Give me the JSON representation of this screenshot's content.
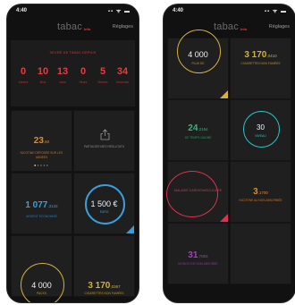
{
  "status": {
    "time": "4:40",
    "icons": "▪▪ ᯤ ▬"
  },
  "app": {
    "logo": "tabac",
    "logo_tag": "Info",
    "settings": "Réglages"
  },
  "left": {
    "quit": {
      "title": "SEVRÉ DE TABAC DEPUIS",
      "counters": [
        {
          "value": "0",
          "unit": "Années"
        },
        {
          "value": "10",
          "unit": "Mois"
        },
        {
          "value": "13",
          "unit": "Jours"
        },
        {
          "value": "0",
          "unit": "Heure"
        },
        {
          "value": "5",
          "unit": "Minutes"
        },
        {
          "value": "34",
          "unit": "Secondes"
        }
      ]
    },
    "tiles": {
      "nicotine": {
        "value": "23",
        "decimal": ",60",
        "label": "NICOTINE DÉPOSÉE SUR LES ANNÉES"
      },
      "share": {
        "label": "PARTAGER MES RÉSULTATS"
      },
      "savings": {
        "value": "1 077",
        "decimal": ",3132",
        "label": "ARGENT ÉCONOMISÉ"
      },
      "goal": {
        "value": "1 500 €",
        "label": "EURO"
      },
      "packs": {
        "value": "4 000",
        "label": "PACKS"
      },
      "cigs": {
        "value": "3 170",
        "decimal": ",0367",
        "label": "CIGARETTES NON FUMÉES"
      }
    },
    "colors": {
      "orange": "#e58a2a",
      "blue": "#3c9ed8",
      "yellow": "#d5b03a"
    }
  },
  "right": {
    "tiles": {
      "packs": {
        "value": "4 000",
        "label": "PLUS DE"
      },
      "cigs": {
        "value": "3 170",
        "decimal": ",0410",
        "label": "CIGARETTES NON FUMÉES"
      },
      "time": {
        "value": "24",
        "decimal": ",2154",
        "label": "DE TEMPS GAGNÉ"
      },
      "level": {
        "value": "30",
        "label": "NIVEAU"
      },
      "disease": {
        "label": "MALADIE CARDIOVASCULAIRE"
      },
      "cigs2": {
        "value": "3",
        "decimal": ",1700",
        "label": "NICOTINE AU NON ABSORBÉE"
      },
      "misc": {
        "value": "31",
        "decimal": ",7004",
        "label": "MONOXYDE NON ABSORBÉ"
      }
    },
    "colors": {
      "green": "#2fb97a",
      "cyan": "#2ac3c8",
      "red": "#e0304f",
      "purple": "#a040c0"
    }
  }
}
